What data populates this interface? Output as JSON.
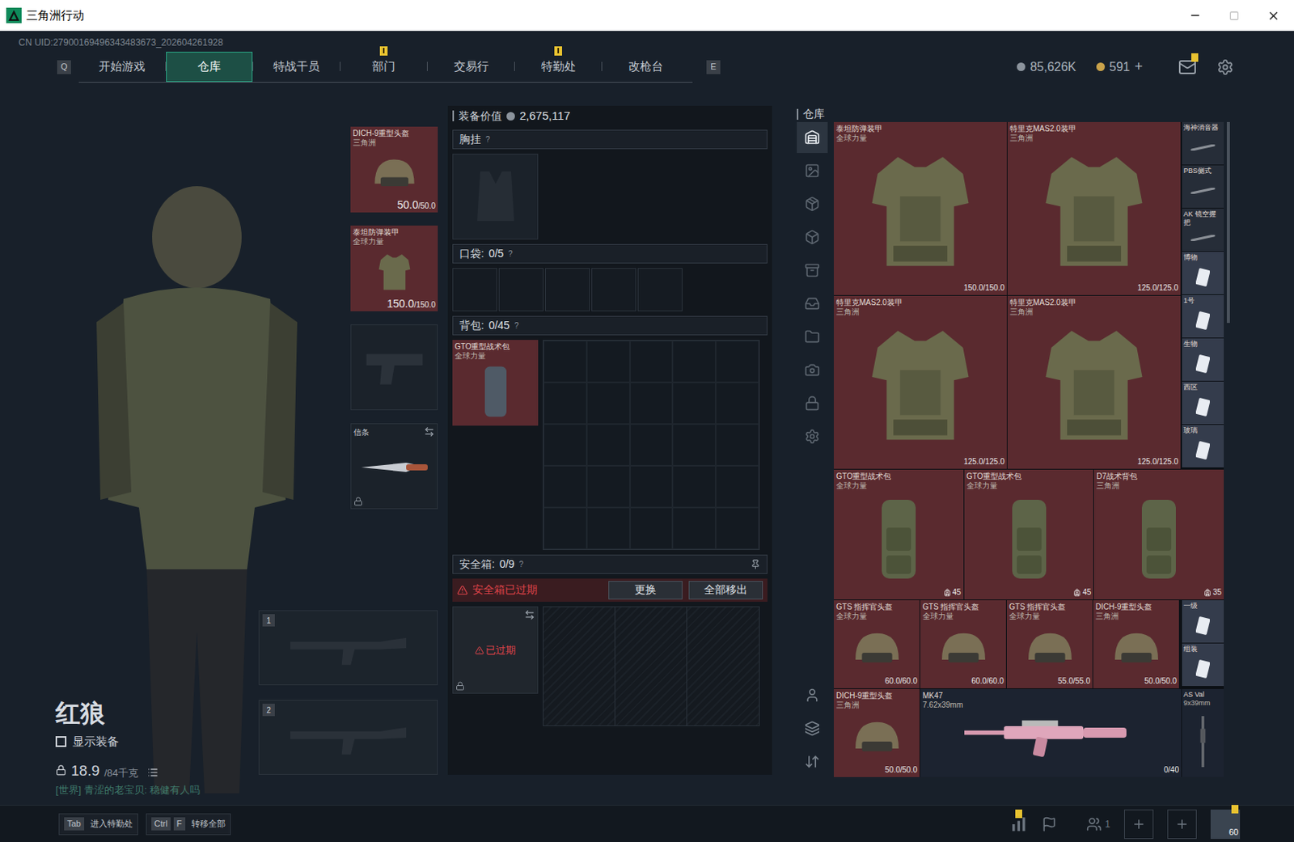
{
  "window": {
    "title": "三角洲行动"
  },
  "uid": "CN UID:27900169496343483673_202604261928",
  "nav": {
    "left_key": "Q",
    "right_key": "E",
    "tabs": [
      {
        "label": "开始游戏",
        "selected": false,
        "badge": false
      },
      {
        "label": "仓库",
        "selected": true,
        "badge": false
      },
      {
        "label": "特战干员",
        "selected": false,
        "badge": false
      },
      {
        "label": "部门",
        "selected": false,
        "badge": true
      },
      {
        "label": "交易行",
        "selected": false,
        "badge": false
      },
      {
        "label": "特勤处",
        "selected": false,
        "badge": true
      },
      {
        "label": "改枪台",
        "selected": false,
        "badge": false
      }
    ]
  },
  "currency": [
    {
      "amount": "85,626K",
      "kind": "coin"
    },
    {
      "amount": "591",
      "kind": "bond",
      "add": "+"
    }
  ],
  "mail_badge": true,
  "character": {
    "name": "红狼",
    "show_equipment": {
      "label": "显示装备",
      "checked": false
    },
    "weight": "18.9",
    "weight_max": "/84千克",
    "chat": "[世界] 青涩的老宝贝: 稳健有人吗"
  },
  "equipment_slots": [
    {
      "kind": "helmet",
      "name": "DICH-9重型头盔",
      "sub": "三角洲",
      "value": "50.0",
      "max": "/50.0",
      "color": "#5a2a2f"
    },
    {
      "kind": "armor",
      "name": "泰坦防弹装甲",
      "sub": "全球力量",
      "value": "150.0",
      "max": "/150.0",
      "color": "#5a2a2f"
    },
    {
      "kind": "pistol"
    },
    {
      "kind": "melee",
      "name": "信条",
      "locked": true
    }
  ],
  "weapon_slots": [
    {
      "number": "1"
    },
    {
      "number": "2"
    }
  ],
  "loadout": {
    "value_label": "装备价值",
    "value": "2,675,117",
    "chest": {
      "label": "胸挂",
      "help": "?"
    },
    "pockets": {
      "label": "口袋:",
      "count": "0/5",
      "help": "?",
      "slots": [
        false,
        false,
        false,
        false,
        false
      ]
    },
    "backpack": {
      "label": "背包:",
      "count": "0/45",
      "help": "?",
      "item": {
        "name": "GTO重型战术包",
        "sub": "全球力量",
        "color": "#5a2a2f"
      }
    },
    "safebox": {
      "label": "安全箱:",
      "count": "0/9",
      "help": "?",
      "warning": "安全箱已过期",
      "buttons": [
        "更换",
        "全部移出"
      ],
      "expired_label": "已过期",
      "expired": true
    }
  },
  "warehouse": {
    "title": "仓库",
    "sidebar": {
      "top": [
        {
          "selected": true
        },
        {
          "selected": false
        },
        {
          "selected": false
        },
        {
          "selected": false
        },
        {
          "selected": false
        },
        {
          "selected": false
        },
        {
          "selected": false
        },
        {
          "selected": false
        },
        {
          "selected": false
        },
        {
          "selected": false
        }
      ],
      "bottom": [
        {
          "selected": false
        },
        {
          "selected": false
        },
        {
          "selected": false
        }
      ]
    },
    "rows": [
      {
        "main": [
          {
            "kind": "armor",
            "name": "泰坦防弹装甲",
            "sub": "全球力量",
            "value": "150.0/150.0",
            "color": "#5a2a2f"
          },
          {
            "kind": "armor",
            "name": "特里克MAS2.0装甲",
            "sub": "三角洲",
            "value": "125.0/125.0",
            "color": "#5a2a2f"
          },
          {
            "kind": "armor",
            "name": "特里克MAS2.0装甲",
            "sub": "三角洲",
            "value": "125.0/125.0",
            "color": "#5a2a2f"
          },
          {
            "kind": "armor",
            "name": "特里克MAS2.0装甲",
            "sub": "三角洲",
            "value": "125.0/125.0",
            "color": "#5a2a2f"
          }
        ],
        "side": [
          {
            "kind": "attachment",
            "name": "海神消音器",
            "color": "#262d38"
          },
          {
            "kind": "attachment",
            "name": "PBS侧式",
            "color": "#262d38"
          },
          {
            "kind": "attachment",
            "name": "AK 镜空握把",
            "color": "#262d38"
          },
          {
            "kind": "card",
            "name": "博物",
            "color": "#343c4c"
          },
          {
            "kind": "card",
            "name": "1号",
            "color": "#343c4c"
          },
          {
            "kind": "card",
            "name": "生物",
            "color": "#343c4c"
          },
          {
            "kind": "card",
            "name": "西区",
            "color": "#343c4c"
          },
          {
            "kind": "card",
            "name": "玻璃",
            "color": "#343c4c"
          }
        ]
      },
      {
        "main": [
          {
            "kind": "backpack",
            "name": "GTO重型战术包",
            "sub": "全球力量",
            "value": "45",
            "color": "#5a2a2f"
          },
          {
            "kind": "backpack",
            "name": "GTO重型战术包",
            "sub": "全球力量",
            "value": "45",
            "color": "#5a2a2f"
          },
          {
            "kind": "backpack",
            "name": "D7战术背包",
            "sub": "三角洲",
            "value": "35",
            "color": "#5a2a2f"
          }
        ],
        "side": []
      },
      {
        "main": [
          {
            "kind": "helmet",
            "name": "GTS 指挥官头盔",
            "sub": "全球力量",
            "value": "60.0/60.0",
            "color": "#5a2a2f"
          },
          {
            "kind": "helmet",
            "name": "GTS 指挥官头盔",
            "sub": "全球力量",
            "value": "60.0/60.0",
            "color": "#5a2a2f"
          },
          {
            "kind": "helmet",
            "name": "GTS 指挥官头盔",
            "sub": "全球力量",
            "value": "55.0/55.0",
            "color": "#5a2a2f"
          },
          {
            "kind": "helmet",
            "name": "DICH-9重型头盔",
            "sub": "三角洲",
            "value": "50.0/50.0",
            "color": "#5a2a2f"
          }
        ],
        "side": [
          {
            "kind": "card",
            "name": "一级",
            "color": "#343c4c"
          },
          {
            "kind": "card",
            "name": "组装",
            "color": "#343c4c"
          }
        ]
      },
      {
        "main": [
          {
            "kind": "helmet",
            "name": "DICH-9重型头盔",
            "sub": "三角洲",
            "value": "50.0/50.0",
            "color": "#5a2a2f"
          },
          {
            "kind": "rifle",
            "name": "MK47",
            "sub": "7.62x39mm",
            "value": "0/40",
            "color": "#1c2330"
          }
        ],
        "side": [
          {
            "kind": "rifle_narrow",
            "name": "AS Val",
            "sub": "9x39mm",
            "color": "#1c2330"
          }
        ]
      }
    ]
  },
  "bottom_bar": {
    "hints": [
      {
        "keys": [
          "Tab"
        ],
        "label": "进入特勤处"
      },
      {
        "keys": [
          "Ctrl",
          "F"
        ],
        "label": "转移全部"
      }
    ],
    "stats_badge": true,
    "squad_count": "1",
    "level": "60",
    "avatar_badge": true
  }
}
